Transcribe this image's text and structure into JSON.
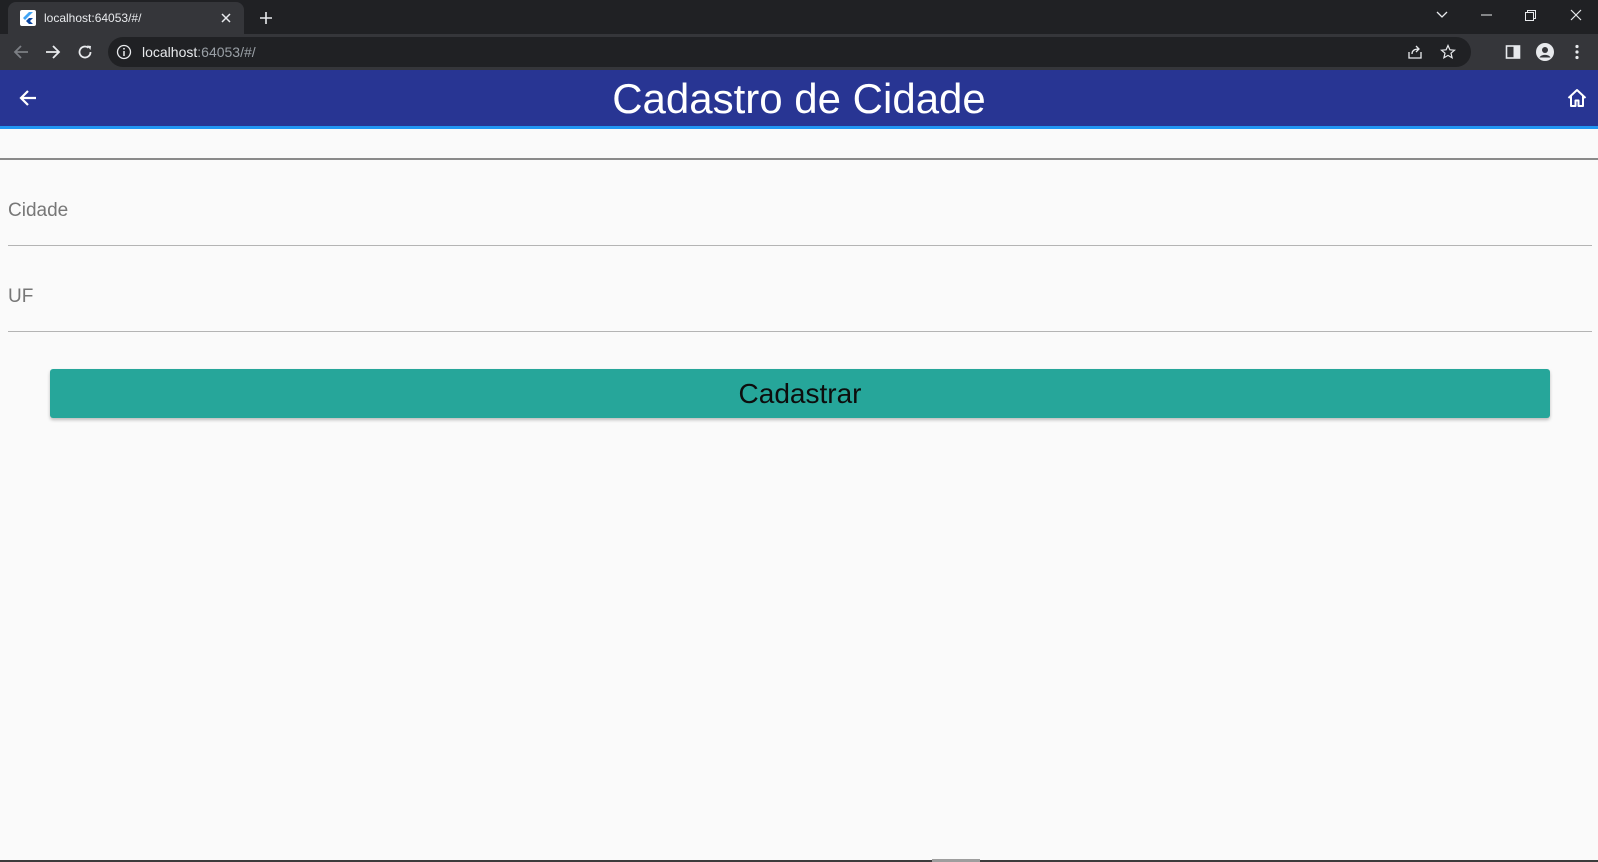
{
  "browser": {
    "tab_title": "localhost:64053/#/",
    "url_host": "localhost",
    "url_rest": ":64053/#/"
  },
  "app": {
    "title": "Cadastro de Cidade",
    "colors": {
      "appbar": "#283593",
      "accent": "#2196f3",
      "button": "#26a69a"
    }
  },
  "form": {
    "city_label": "Cidade",
    "city_value": "",
    "uf_label": "UF",
    "uf_value": "",
    "submit_label": "Cadastrar"
  }
}
